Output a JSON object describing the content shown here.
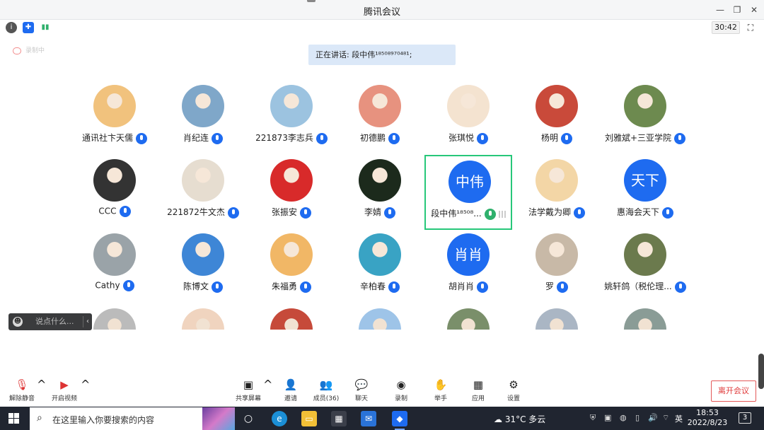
{
  "window": {
    "title": "腾讯会议"
  },
  "status": {
    "timer": "30:42",
    "icons": [
      "info-icon",
      "shield-icon",
      "signal-icon"
    ]
  },
  "recording_label": "录制中",
  "speaking": {
    "text": "正在讲话: 段中伟¹⁸⁵⁰⁸⁹⁷⁰⁴⁸¹;"
  },
  "participants": [
    {
      "name": "通讯社卞天儒",
      "avatar": "photo",
      "color": "#f1c27d"
    },
    {
      "name": "肖纪连",
      "avatar": "photo",
      "color": "#7fa7c9"
    },
    {
      "name": "221873李志兵",
      "avatar": "photo",
      "color": "#9cc3e0"
    },
    {
      "name": "初德鹏",
      "avatar": "photo",
      "color": "#e7927f"
    },
    {
      "name": "张琪悦",
      "avatar": "photo",
      "color": "#f4e3d0"
    },
    {
      "name": "杨明",
      "avatar": "photo",
      "color": "#c94a3a"
    },
    {
      "name": "刘雅斌+三亚学院",
      "avatar": "photo",
      "color": "#6d8a4f"
    },
    {
      "name": "CCC",
      "avatar": "photo",
      "color": "#333333"
    },
    {
      "name": "221872牛文杰",
      "avatar": "photo",
      "color": "#e6ddd0"
    },
    {
      "name": "张振安",
      "avatar": "photo",
      "color": "#d82a2a"
    },
    {
      "name": "李婧",
      "avatar": "photo",
      "color": "#1c2a1c"
    },
    {
      "name": "段中伟¹⁸⁵⁰⁸...",
      "avatar": "initials",
      "initials": "中伟",
      "active": true
    },
    {
      "name": "法学戴为卿",
      "avatar": "photo",
      "color": "#f3d6a6"
    },
    {
      "name": "惠海会天下",
      "avatar": "initials",
      "initials": "天下"
    },
    {
      "name": "Cathy",
      "avatar": "photo",
      "color": "#9aa3a8"
    },
    {
      "name": "陈博文",
      "avatar": "photo",
      "color": "#3e86d6"
    },
    {
      "name": "朱福勇",
      "avatar": "photo",
      "color": "#f1b766"
    },
    {
      "name": "辛柏春",
      "avatar": "photo",
      "color": "#39a3c4"
    },
    {
      "name": "胡肖肖",
      "avatar": "initials",
      "initials": "肖肖"
    },
    {
      "name": "罗",
      "avatar": "photo",
      "color": "#c8b9a7"
    },
    {
      "name": "姚轩鸽（税伦理...",
      "avatar": "photo",
      "color": "#6b7a4d"
    }
  ],
  "partial_row_colors": [
    "#bbbbbb",
    "#f0d4bf",
    "#c64a3a",
    "#9ec4e8",
    "#7a8f6a",
    "#aab6c4",
    "#8a9c96"
  ],
  "chat": {
    "placeholder": "说点什么..."
  },
  "toolbar": {
    "unmute": "解除静音",
    "video": "开启视频",
    "share": "共享屏幕",
    "invite": "邀请",
    "members": "成员(36)",
    "chat": "聊天",
    "record": "录制",
    "raise_hand": "举手",
    "apps": "应用",
    "settings": "设置",
    "leave": "离开会议"
  },
  "taskbar": {
    "search_placeholder": "在这里输入你要搜索的内容",
    "weather": "31°C 多云",
    "ime": "英",
    "time": "18:53",
    "date": "2022/8/23",
    "notifications": "3"
  }
}
